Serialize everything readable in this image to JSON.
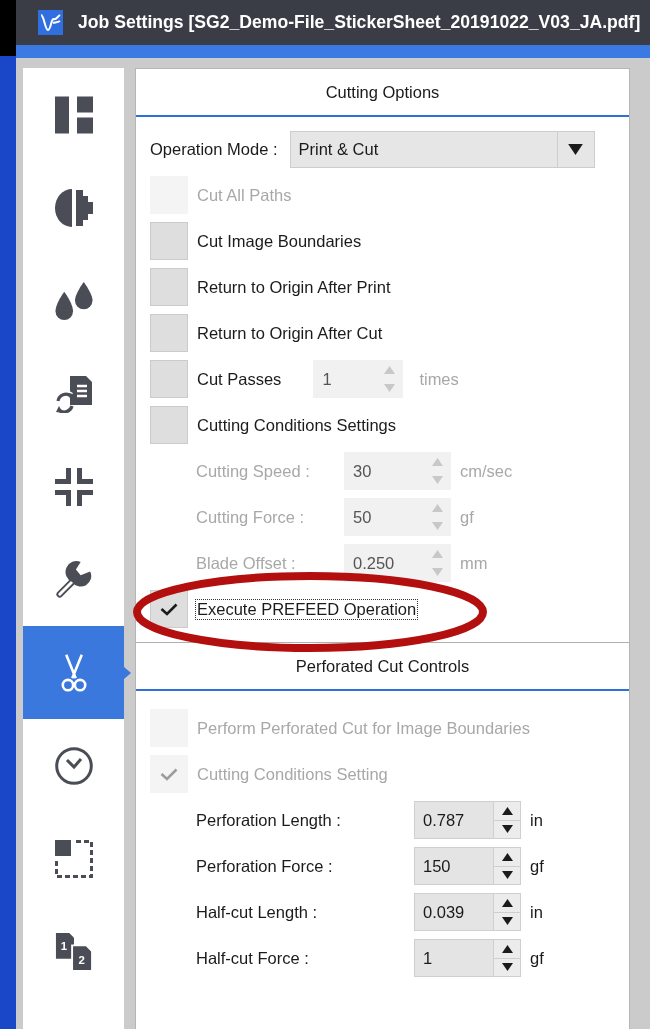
{
  "window": {
    "title": "Job Settings [SG2_Demo-File_StickerSheet_20191022_V03_JA.pdf]"
  },
  "sidebar": {
    "items": [
      {
        "selected": false
      },
      {
        "selected": false
      },
      {
        "selected": false
      },
      {
        "selected": false
      },
      {
        "selected": false
      },
      {
        "selected": false
      },
      {
        "selected": true
      },
      {
        "selected": false
      },
      {
        "selected": false
      },
      {
        "selected": false,
        "numbers": [
          "1",
          "2"
        ]
      }
    ]
  },
  "cutting_options": {
    "title": "Cutting Options",
    "operation_mode": {
      "label": "Operation Mode :",
      "value": "Print & Cut"
    },
    "items": [
      {
        "kind": "checkbox",
        "label": "Cut All Paths",
        "checked": false,
        "disabled": true,
        "focused": false,
        "highlighted": false
      },
      {
        "kind": "checkbox",
        "label": "Cut Image Boundaries",
        "checked": false,
        "disabled": false,
        "focused": false,
        "highlighted": false
      },
      {
        "kind": "checkbox",
        "label": "Return to Origin After Print",
        "checked": false,
        "disabled": false,
        "focused": false,
        "highlighted": false
      },
      {
        "kind": "checkbox",
        "label": "Return to Origin After Cut",
        "checked": false,
        "disabled": false,
        "focused": false,
        "highlighted": false
      },
      {
        "kind": "checkspin",
        "label": "Cut Passes",
        "checked": false,
        "disabled": false,
        "focused": false,
        "highlighted": false,
        "value": "1",
        "unit": "times",
        "field_disabled": true
      },
      {
        "kind": "checkbox",
        "label": "Cutting Conditions Settings",
        "checked": false,
        "disabled": false,
        "focused": false,
        "highlighted": false
      },
      {
        "kind": "field",
        "label": "Cutting Speed :",
        "value": "30",
        "unit": "cm/sec",
        "disabled": true
      },
      {
        "kind": "field",
        "label": "Cutting Force :",
        "value": "50",
        "unit": "gf",
        "disabled": true
      },
      {
        "kind": "field",
        "label": "Blade Offset :",
        "value": "0.250",
        "unit": "mm",
        "disabled": true
      },
      {
        "kind": "checkbox",
        "label": "Execute PREFEED Operation",
        "checked": true,
        "disabled": false,
        "focused": true,
        "highlighted": true
      }
    ]
  },
  "perforated_cut_controls": {
    "title": "Perforated Cut Controls",
    "items": [
      {
        "kind": "checkbox",
        "label": "Perform Perforated Cut for Image Boundaries",
        "checked": false,
        "disabled": true,
        "focused": false,
        "highlighted": false
      },
      {
        "kind": "checkbox",
        "label": "Cutting Conditions Setting",
        "checked": true,
        "disabled": true,
        "focused": false,
        "highlighted": false
      },
      {
        "kind": "field",
        "label": "Perforation Length :",
        "value": "0.787",
        "unit": "in",
        "disabled": false
      },
      {
        "kind": "field",
        "label": "Perforation Force :",
        "value": "150",
        "unit": "gf",
        "disabled": false
      },
      {
        "kind": "field",
        "label": "Half-cut Length :",
        "value": "0.039",
        "unit": "in",
        "disabled": false
      },
      {
        "kind": "field",
        "label": "Half-cut Force :",
        "value": "1",
        "unit": "gf",
        "disabled": false
      }
    ]
  }
}
